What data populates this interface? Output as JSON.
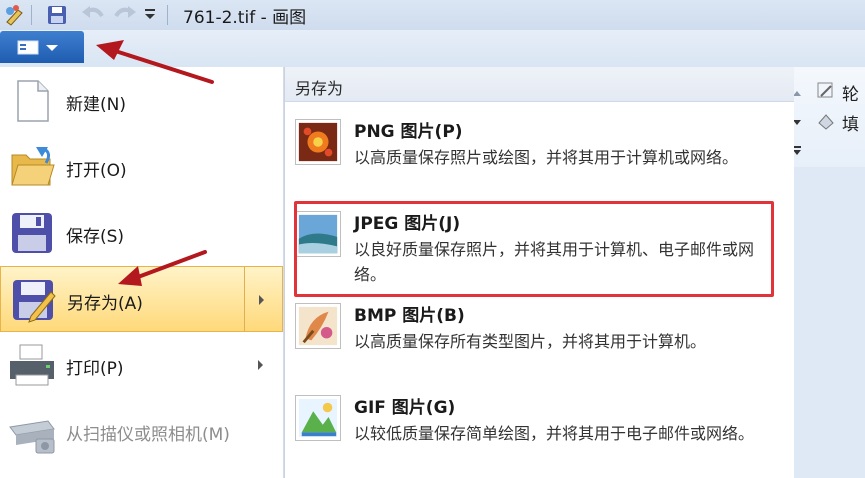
{
  "window": {
    "title": "761-2.tif - 画图"
  },
  "quick_access": {
    "icons": [
      "paint-app-icon",
      "save-icon",
      "undo-icon",
      "redo-icon",
      "customize-dropdown-icon"
    ]
  },
  "app_menu": {
    "button_icon": "app-menu-icon"
  },
  "left_menu": {
    "items": [
      {
        "label": "新建(N)",
        "icon": "new-file-icon"
      },
      {
        "label": "打开(O)",
        "icon": "open-folder-icon"
      },
      {
        "label": "保存(S)",
        "icon": "save-disk-icon"
      },
      {
        "label": "另存为(A)",
        "icon": "save-as-icon"
      },
      {
        "label": "打印(P)",
        "icon": "printer-icon"
      },
      {
        "label": "从扫描仪或照相机(M)",
        "icon": "scanner-icon"
      }
    ]
  },
  "save_as_menu": {
    "header": "另存为",
    "items": [
      {
        "name": "PNG 图片(P)",
        "desc": "以高质量保存照片或绘图，并将其用于计算机或网络。",
        "icon": "png-image-icon"
      },
      {
        "name": "JPEG 图片(J)",
        "desc": "以良好质量保存照片，并将其用于计算机、电子邮件或网络。",
        "icon": "jpeg-image-icon"
      },
      {
        "name": "BMP 图片(B)",
        "desc": "以高质量保存所有类型图片，并将其用于计算机。",
        "icon": "bmp-image-icon"
      },
      {
        "name": "GIF 图片(G)",
        "desc": "以较低质量保存简单绘图，并将其用于电子邮件或网络。",
        "icon": "gif-image-icon"
      }
    ]
  },
  "ribbon": {
    "outline_label": "轮",
    "fill_label": "填"
  },
  "colors": {
    "highlight_border": "#e0343a",
    "annotation_arrow": "#b3181e",
    "active_item": "#ffd97a"
  }
}
